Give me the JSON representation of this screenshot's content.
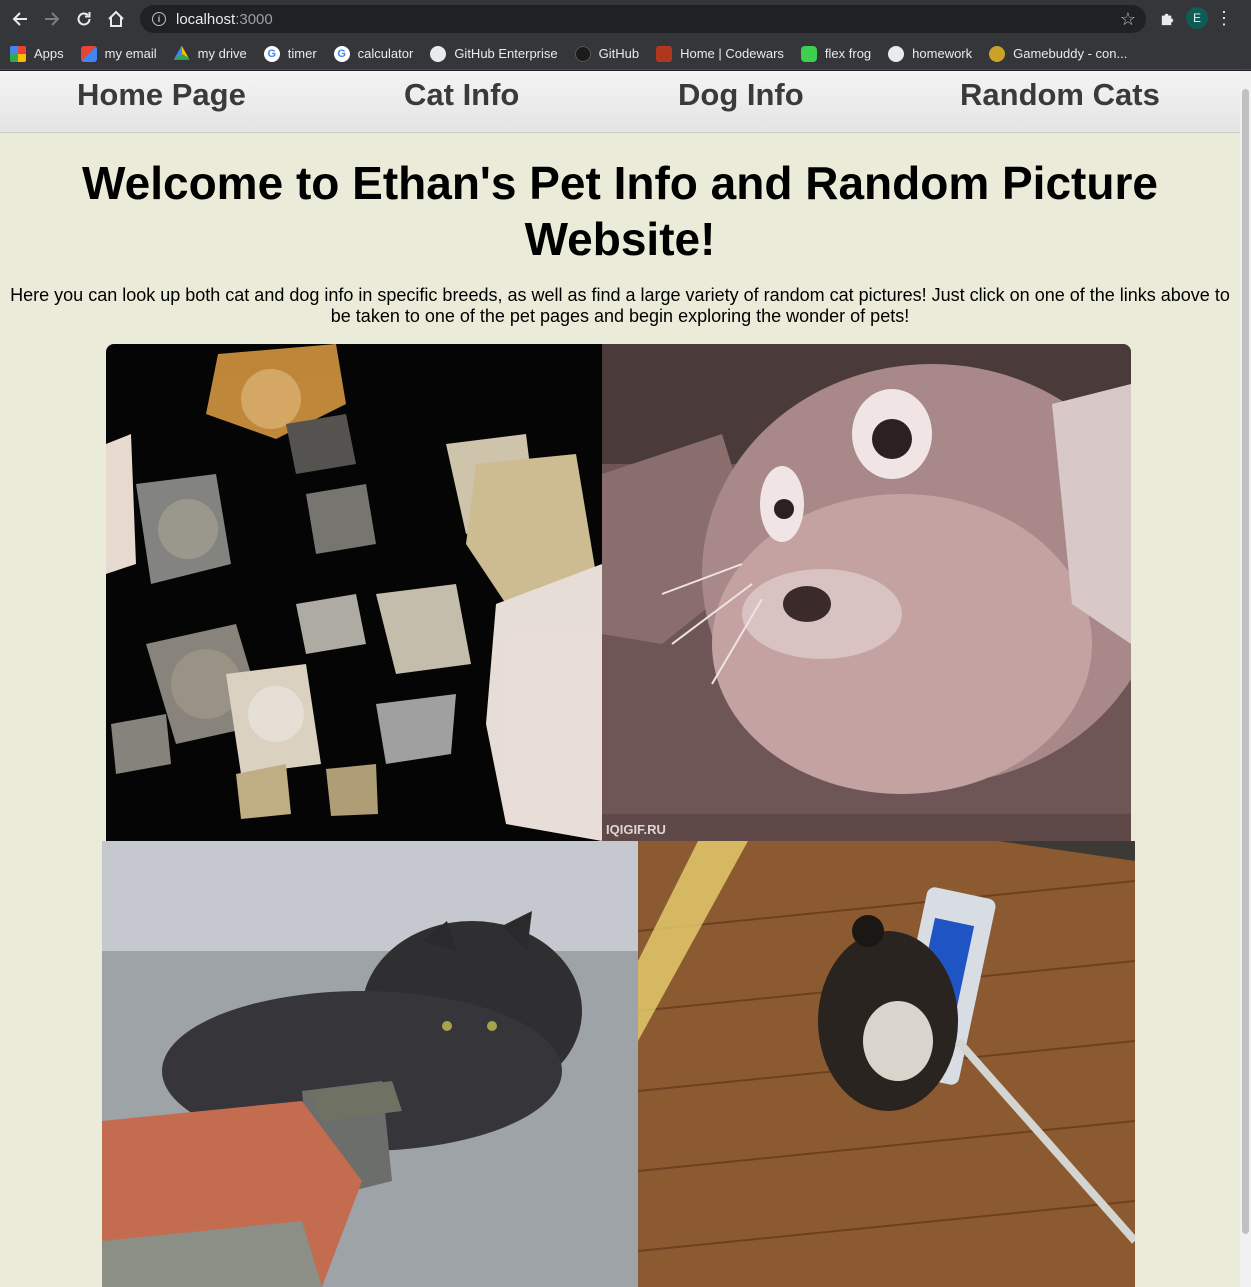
{
  "browser": {
    "url_host": "localhost",
    "url_rest": ":3000",
    "avatar_letter": "E",
    "bookmarks": [
      {
        "label": "Apps",
        "icon": "apps-grid-icon"
      },
      {
        "label": "my email",
        "icon": "gmail-icon"
      },
      {
        "label": "my drive",
        "icon": "google-drive-icon"
      },
      {
        "label": "timer",
        "icon": "google-icon"
      },
      {
        "label": "calculator",
        "icon": "google-icon"
      },
      {
        "label": "GitHub Enterprise",
        "icon": "github-icon"
      },
      {
        "label": "GitHub",
        "icon": "github-icon"
      },
      {
        "label": "Home | Codewars",
        "icon": "codewars-icon"
      },
      {
        "label": "flex frog",
        "icon": "frog-icon"
      },
      {
        "label": "homework",
        "icon": "github-icon"
      },
      {
        "label": "Gamebuddy - con...",
        "icon": "gamebuddy-icon"
      }
    ]
  },
  "site_nav": {
    "home": "Home Page",
    "cat_info": "Cat Info",
    "dog_info": "Dog Info",
    "random_cats": "Random Cats"
  },
  "main": {
    "headline": "Welcome to Ethan's Pet Info and Random Picture Website!",
    "intro": "Here you can look up both cat and dog info in specific breeds, as well as find a large variety of random cat pictures! Just click on one of the links above to be taken to one of the pet pages and begin exploring the wonder of pets!",
    "gifs": [
      {
        "name": "floating-cat-faces-gif"
      },
      {
        "name": "surprised-cat-gif",
        "watermark": "IQIGIF.RU"
      },
      {
        "name": "kitten-with-money-gif"
      },
      {
        "name": "cat-on-mop-gif"
      }
    ]
  },
  "colors": {
    "page_background": "#ebebd9",
    "nav_text": "#3a3a3a",
    "chrome_toolbar": "#35363a"
  }
}
